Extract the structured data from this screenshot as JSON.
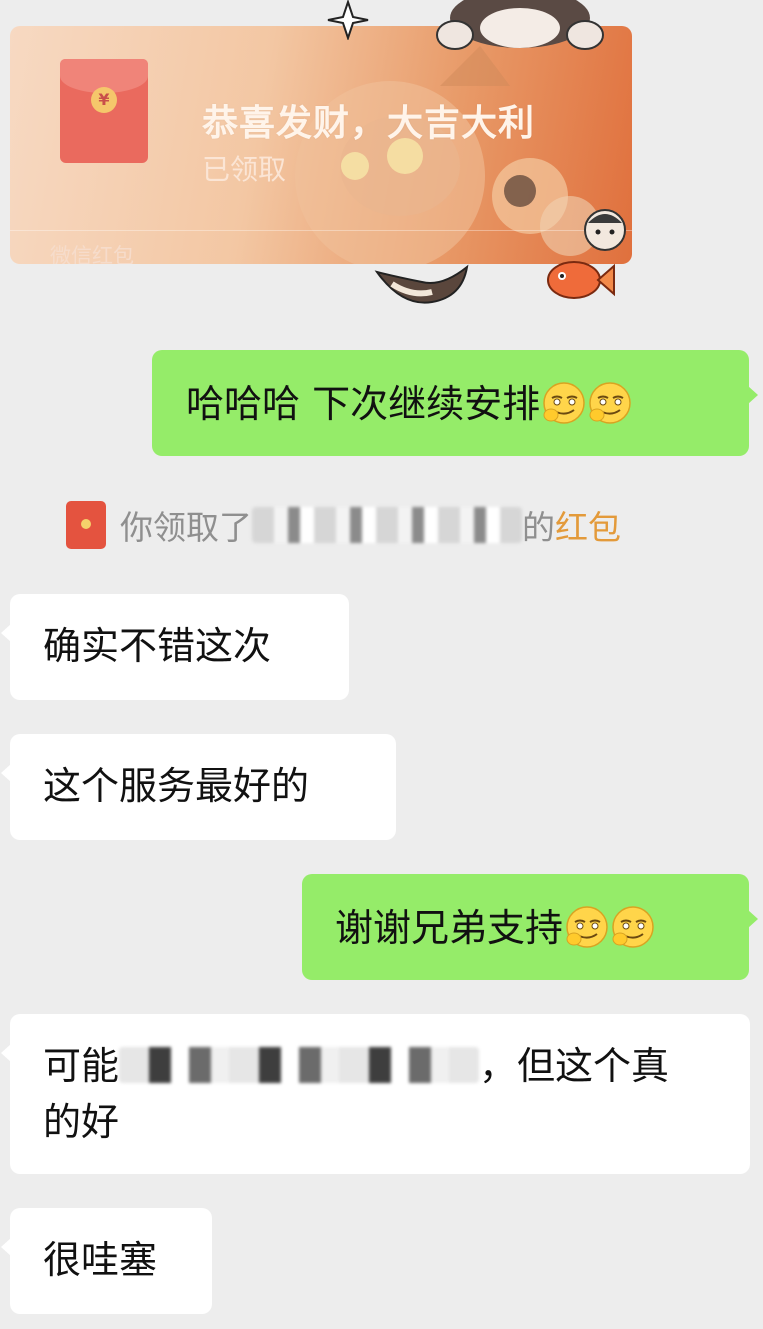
{
  "red_packet": {
    "title": "恭喜发财，大吉大利",
    "status": "已领取",
    "footer": "微信红包"
  },
  "messages": [
    {
      "side": "out",
      "text": "哈哈哈 下次继续安排",
      "emoji_count": 2,
      "emoji": "smirk-emoji"
    },
    {
      "side": "system",
      "prefix": "你领取了",
      "redacted": true,
      "suffix": "的",
      "link": "红包"
    },
    {
      "side": "in",
      "text": "确实不错这次"
    },
    {
      "side": "in",
      "text": "这个服务最好的"
    },
    {
      "side": "out",
      "text": "谢谢兄弟支持",
      "emoji_count": 2,
      "emoji": "smirk-emoji"
    },
    {
      "side": "in",
      "line1_prefix": "可能",
      "redacted": true,
      "line1_suffix": "，但这个真",
      "line2": "的好"
    },
    {
      "side": "in",
      "text": "很哇塞"
    }
  ],
  "colors": {
    "background": "#ededed",
    "outgoing_bubble": "#95ec69",
    "incoming_bubble": "#ffffff",
    "system_text": "#8f8f8f",
    "link": "#e39a3a"
  }
}
